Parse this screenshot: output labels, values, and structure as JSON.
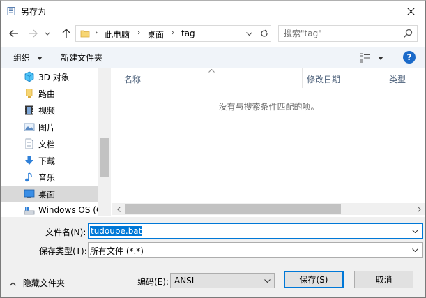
{
  "window": {
    "title": "另存为"
  },
  "nav": {
    "breadcrumbs": [
      "此电脑",
      "桌面",
      "tag"
    ],
    "search_placeholder": "搜索\"tag\""
  },
  "toolbar": {
    "organize": "组织",
    "new_folder": "新建文件夹"
  },
  "sidebar": {
    "items": [
      {
        "label": "3D 对象",
        "icon": "cube-3d-icon"
      },
      {
        "label": "路由",
        "icon": "folder-yellow-icon"
      },
      {
        "label": "视频",
        "icon": "film-icon"
      },
      {
        "label": "图片",
        "icon": "picture-icon"
      },
      {
        "label": "文档",
        "icon": "document-icon"
      },
      {
        "label": "下载",
        "icon": "download-arrow-icon"
      },
      {
        "label": "音乐",
        "icon": "music-note-icon"
      },
      {
        "label": "桌面",
        "icon": "desktop-icon",
        "selected": true
      },
      {
        "label": "Windows OS (C",
        "icon": "drive-icon"
      }
    ]
  },
  "columns": {
    "name": "名称",
    "modified": "修改日期",
    "type": "类型"
  },
  "content": {
    "empty_message": "没有与搜索条件匹配的项。"
  },
  "form": {
    "filename_label": "文件名(N):",
    "filename_value": "tudoupe.bat",
    "filetype_label": "保存类型(T):",
    "filetype_value": "所有文件  (*.*)",
    "encoding_label": "编码(E):",
    "encoding_value": "ANSI",
    "hide_folders": "隐藏文件夹",
    "save": "保存(S)",
    "cancel": "取消"
  },
  "colors": {
    "accent": "#0078d7",
    "selected_row": "#d9d9d9",
    "toolbar_bg": "#f0f4f9",
    "form_bg": "#f0f0f0"
  }
}
